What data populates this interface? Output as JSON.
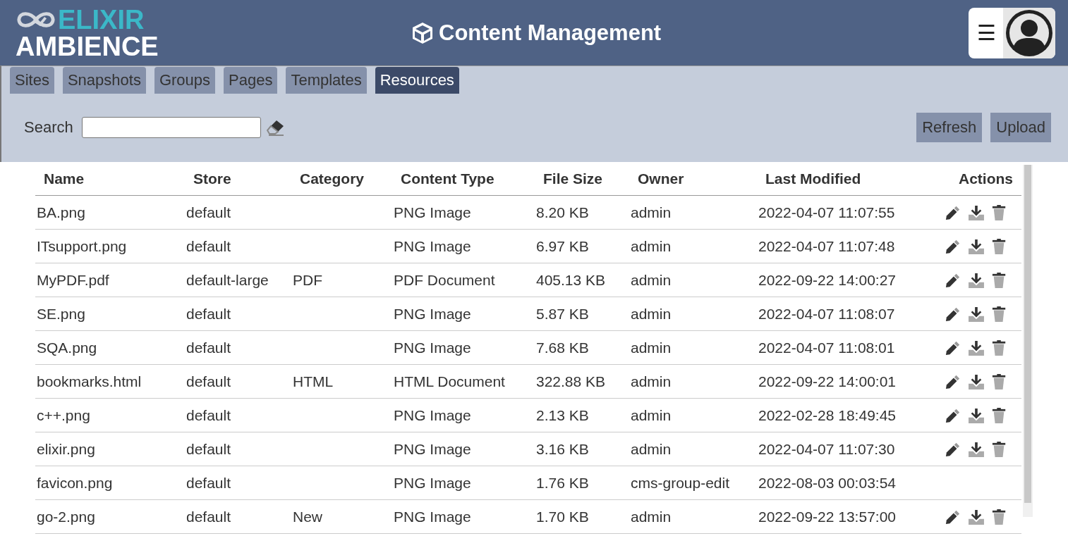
{
  "logo": {
    "line1": "ELIXIR",
    "line2": "AMBIENCE"
  },
  "title": "Content Management",
  "menu": {
    "icon": "☰"
  },
  "tabs": [
    {
      "label": "Sites",
      "selected": false
    },
    {
      "label": "Snapshots",
      "selected": false
    },
    {
      "label": "Groups",
      "selected": false
    },
    {
      "label": "Pages",
      "selected": false
    },
    {
      "label": "Templates",
      "selected": false
    },
    {
      "label": "Resources",
      "selected": true
    }
  ],
  "search": {
    "label": "Search"
  },
  "buttons": [
    "Refresh",
    "Upload"
  ],
  "table": {
    "columns": [
      "Name",
      "Store",
      "Category",
      "Content Type",
      "File Size",
      "Owner",
      "Last Modified",
      "Actions"
    ],
    "rows": [
      {
        "cells": [
          "BA.png",
          "default",
          "",
          "PNG Image",
          "8.20 KB",
          "admin",
          "2022-04-07 11:07:55"
        ],
        "actions": true
      },
      {
        "cells": [
          "ITsupport.png",
          "default",
          "",
          "PNG Image",
          "6.97 KB",
          "admin",
          "2022-04-07 11:07:48"
        ],
        "actions": true
      },
      {
        "cells": [
          "MyPDF.pdf",
          "default-large",
          "PDF",
          "PDF Document",
          "405.13 KB",
          "admin",
          "2022-09-22 14:00:27"
        ],
        "actions": true
      },
      {
        "cells": [
          "SE.png",
          "default",
          "",
          "PNG Image",
          "5.87 KB",
          "admin",
          "2022-04-07 11:08:07"
        ],
        "actions": true
      },
      {
        "cells": [
          "SQA.png",
          "default",
          "",
          "PNG Image",
          "7.68 KB",
          "admin",
          "2022-04-07 11:08:01"
        ],
        "actions": true
      },
      {
        "cells": [
          "bookmarks.html",
          "default",
          "HTML",
          "HTML Document",
          "322.88 KB",
          "admin",
          "2022-09-22 14:00:01"
        ],
        "actions": true
      },
      {
        "cells": [
          "c++.png",
          "default",
          "",
          "PNG Image",
          "2.13 KB",
          "admin",
          "2022-02-28 18:49:45"
        ],
        "actions": true
      },
      {
        "cells": [
          "elixir.png",
          "default",
          "",
          "PNG Image",
          "3.16 KB",
          "admin",
          "2022-04-07 11:07:30"
        ],
        "actions": true
      },
      {
        "cells": [
          "favicon.png",
          "default",
          "",
          "PNG Image",
          "1.76 KB",
          "cms-group-edit",
          "2022-08-03 00:03:54"
        ],
        "actions": false
      },
      {
        "cells": [
          "go-2.png",
          "default",
          "New",
          "PNG Image",
          "1.70 KB",
          "admin",
          "2022-09-22 13:57:00"
        ],
        "actions": true
      }
    ]
  }
}
